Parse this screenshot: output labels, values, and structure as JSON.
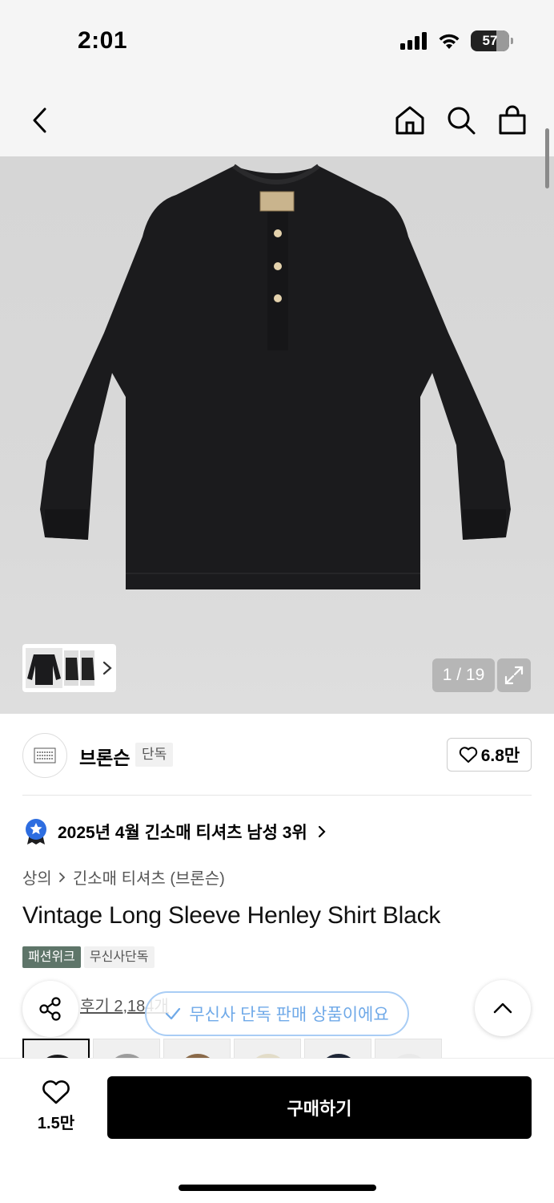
{
  "status_bar": {
    "time": "2:01",
    "battery": "57"
  },
  "nav": {
    "back_icon": "chevron-left-icon",
    "home_icon": "home-icon",
    "search_icon": "search-icon",
    "bag_icon": "shopping-bag-icon"
  },
  "gallery": {
    "counter": "1 / 19",
    "expand_icon": "expand-icon"
  },
  "brand": {
    "name": "브론슨",
    "badge": "단독",
    "likes": "6.8만"
  },
  "ranking": {
    "text": "2025년 4월 긴소매 티셔츠 남성 3위",
    "badge_color": "#2d6de0"
  },
  "category": {
    "parent": "상의",
    "child": "긴소매 티셔츠 (브론슨)"
  },
  "product": {
    "title": "Vintage Long Sleeve Henley Shirt Black"
  },
  "tags": [
    "패션위크",
    "무신사단독"
  ],
  "review": {
    "text": "후기 2,184개"
  },
  "toast": {
    "text": "무신사 단독 판매 상품이에요"
  },
  "bottom": {
    "likes": "1.5만",
    "buy_label": "구매하기"
  },
  "colors": {
    "tag_green": "#5e7569",
    "toast_blue": "#6fa9e8",
    "buy_button": "#000000"
  }
}
